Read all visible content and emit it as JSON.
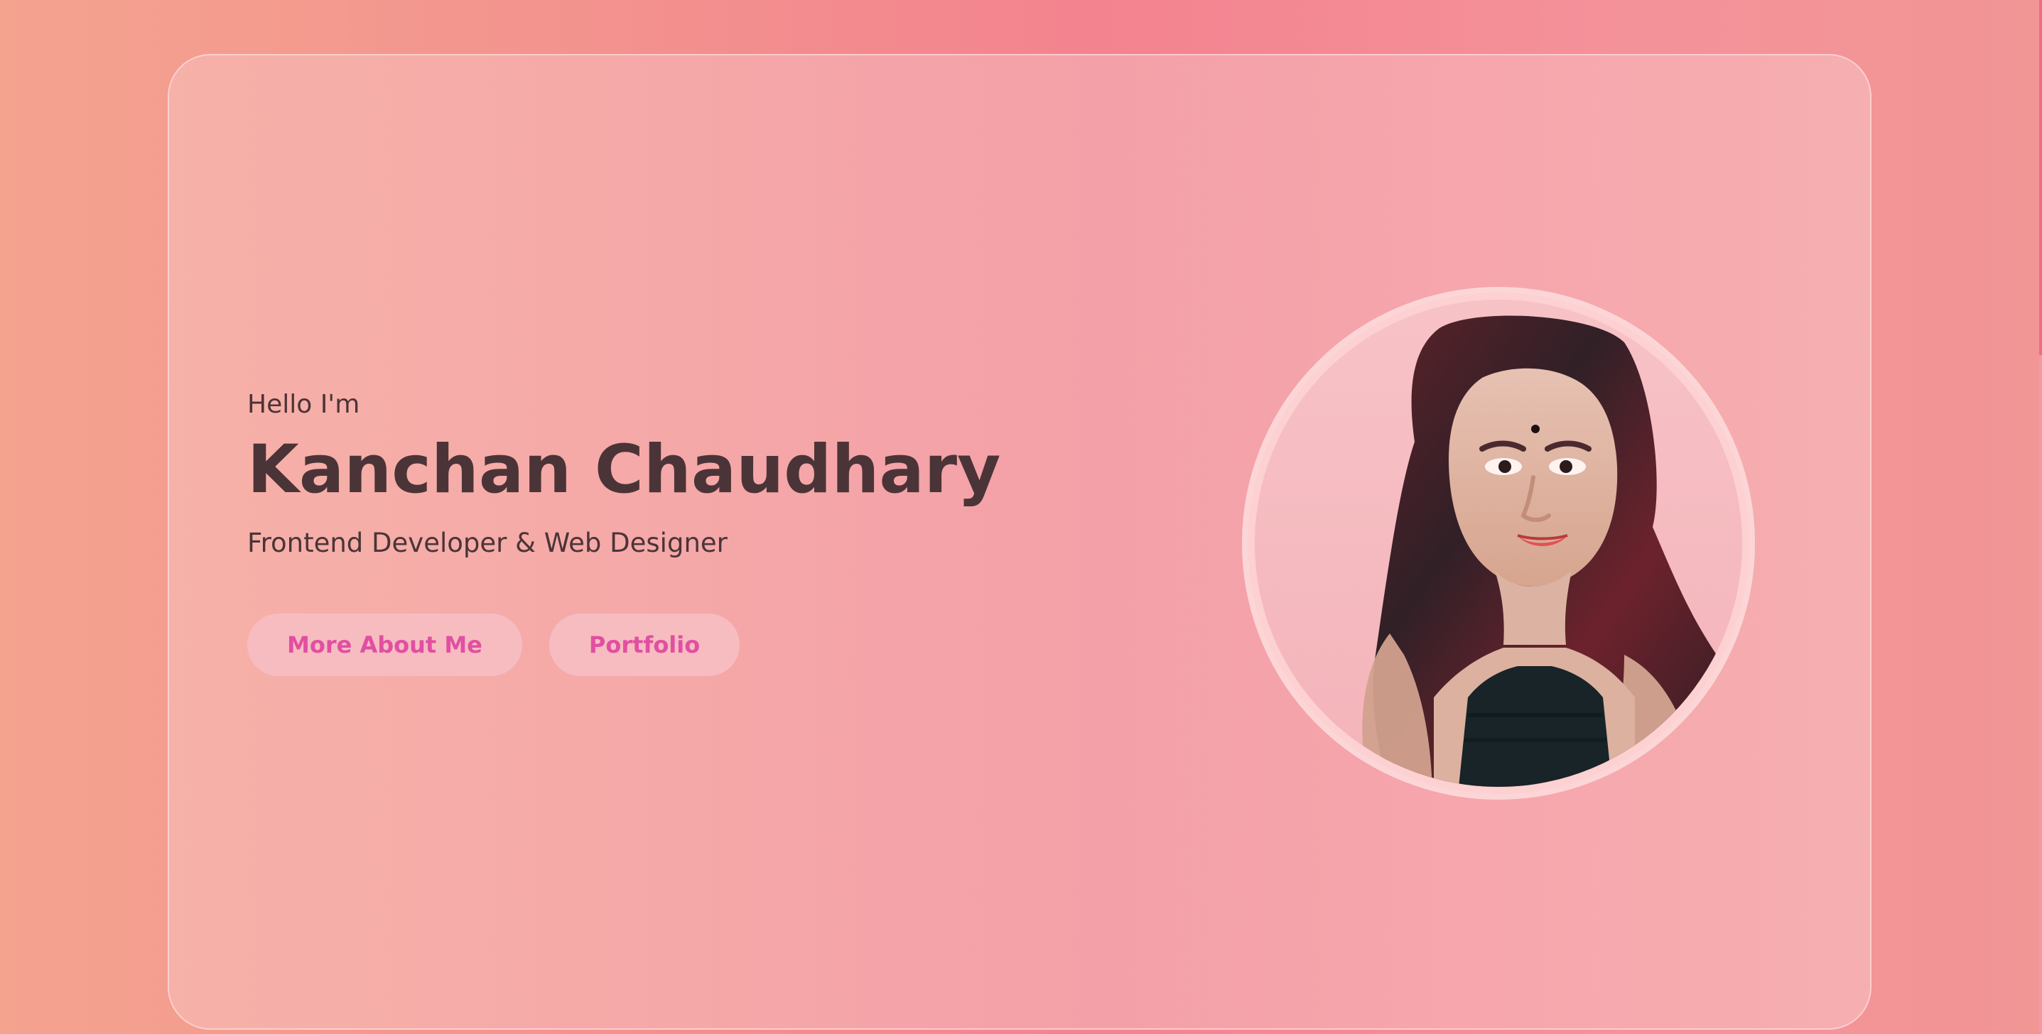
{
  "hero": {
    "greeting": "Hello I'm",
    "name": "Kanchan Chaudhary",
    "role": "Frontend Developer & Web Designer",
    "buttons": {
      "about": "More About Me",
      "portfolio": "Portfolio"
    },
    "photo": {
      "icon": "profile-photo",
      "alt": "Profile photo"
    }
  },
  "colors": {
    "background": "#f3838f",
    "card": "#f4a0a8",
    "text": "#4b3437",
    "button_bg": "#f7bcc0",
    "button_text": "#e14fa2",
    "photo_ring": "#fcd6d7"
  }
}
